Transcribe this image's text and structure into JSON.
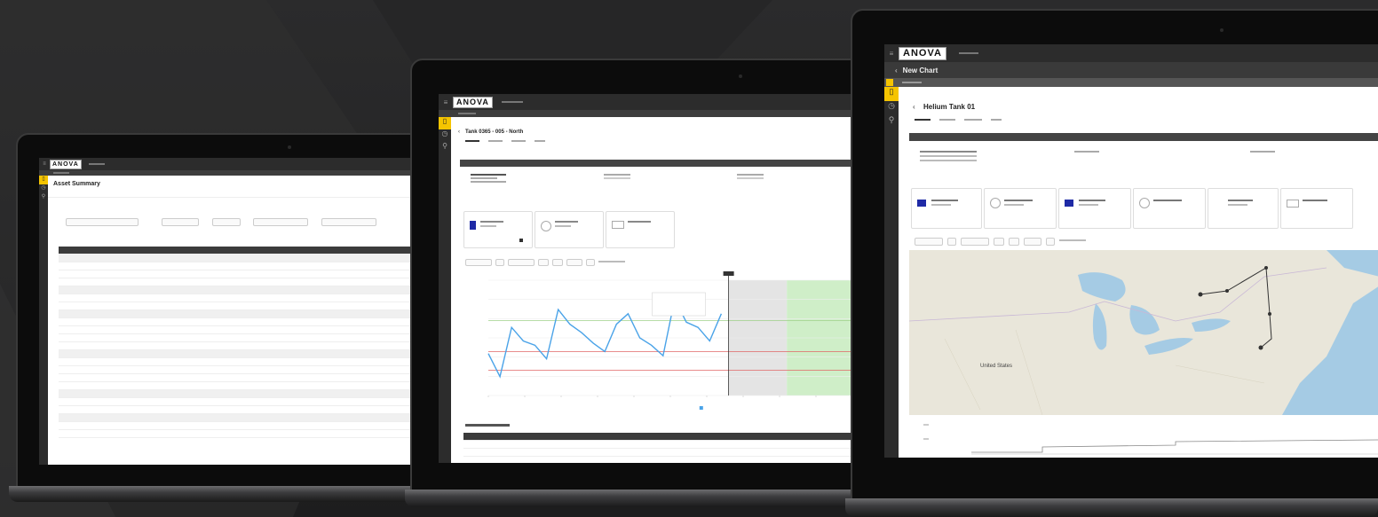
{
  "brand": {
    "logo_text": "ANOVA",
    "yellow": "#f5c400",
    "dark": "#2c2c2c",
    "chart_blue": "#4aa3e8",
    "shade_green": "#cfeec8",
    "shade_gray": "#e4e4e4"
  },
  "left_laptop": {
    "page_title": "Asset Summary"
  },
  "middle_laptop": {
    "page_title": "Tank 0365 - 005 - North",
    "chart_series": [
      120,
      98,
      145,
      132,
      128,
      115,
      162,
      148,
      140,
      130,
      122,
      148,
      158,
      135,
      128,
      118,
      172,
      150,
      145,
      132,
      158
    ]
  },
  "right_laptop": {
    "header_title": "New Chart",
    "page_title": "Helium Tank 01",
    "map_label": "United States"
  }
}
